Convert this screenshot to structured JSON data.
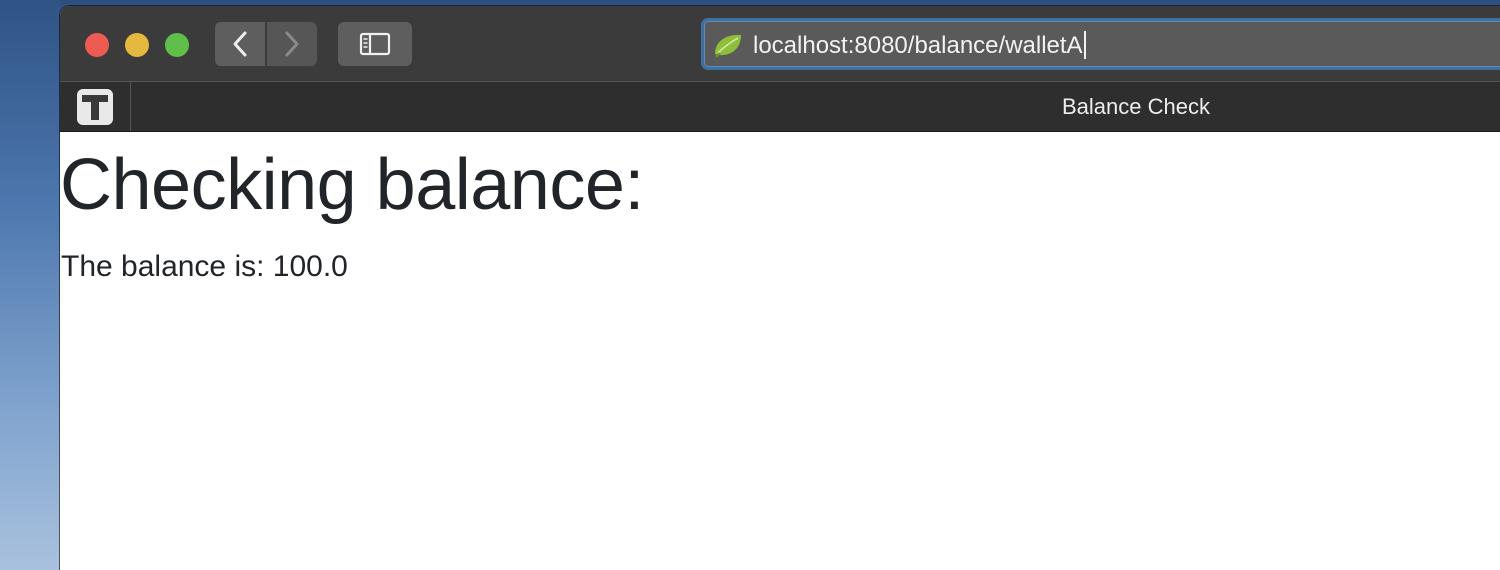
{
  "browser": {
    "address_bar": {
      "url": "localhost:8080/balance/walletA",
      "favicon": "spring-leaf-icon"
    },
    "toolbar": {
      "back_icon": "chevron-left-icon",
      "forward_icon": "chevron-right-icon",
      "sidebar_icon": "sidebar-icon"
    },
    "tabs": {
      "pinned_icon": "t-app-icon",
      "active_tab_title": "Balance Check"
    }
  },
  "page": {
    "heading": "Checking balance:",
    "balance_line": "The balance is: 100.0"
  },
  "colors": {
    "close": "#ee5b53",
    "minimize": "#e5b840",
    "maximize": "#5fbf4a",
    "text": "#212529",
    "address_focus": "#3f6f9e"
  }
}
